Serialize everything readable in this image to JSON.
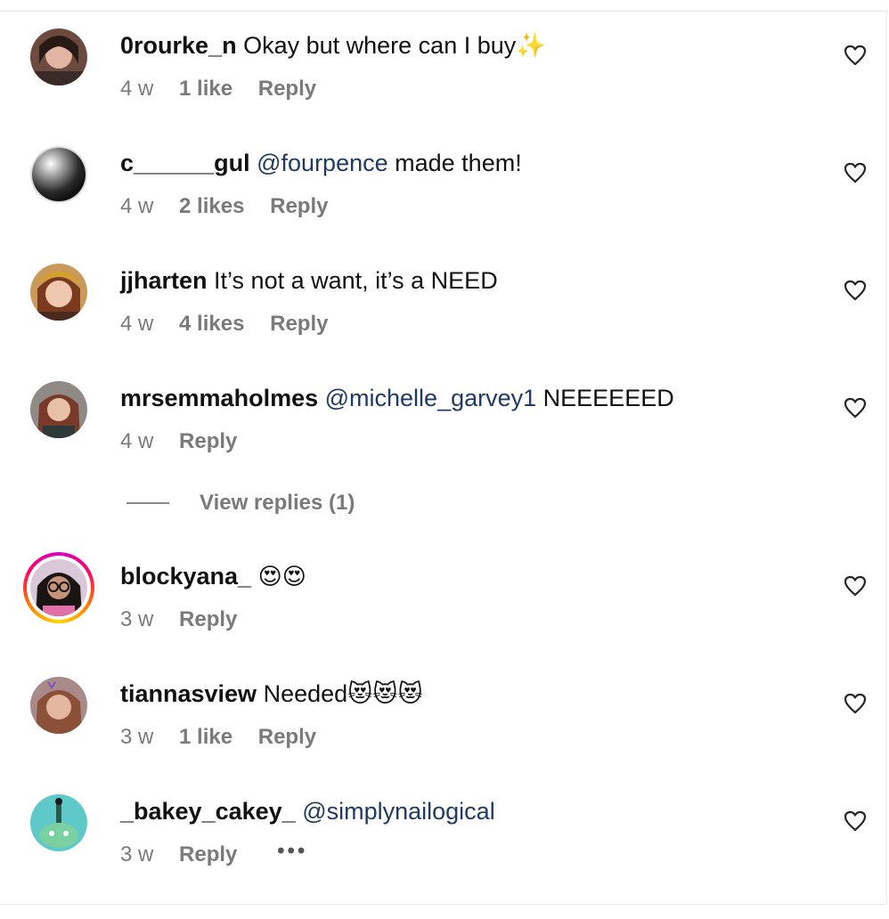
{
  "comments": [
    {
      "username": "0rourke_n",
      "mention": "",
      "text": "Okay but where can I buy✨",
      "time": "4 w",
      "likes": "1 like",
      "reply": "Reply",
      "avatar": "avatar-woman-dark-hair"
    },
    {
      "username": "c______gul",
      "mention": "@fourpence",
      "text": "made them!",
      "time": "4 w",
      "likes": "2 likes",
      "reply": "Reply",
      "avatar": "avatar-chrome-sphere"
    },
    {
      "username": "jjharten",
      "mention": "",
      "text": "It’s not a want, it’s a NEED",
      "time": "4 w",
      "likes": "4 likes",
      "reply": "Reply",
      "avatar": "avatar-woman-smiling"
    },
    {
      "username": "mrsemmaholmes",
      "mention": "@michelle_garvey1",
      "text": "NEEEEEED",
      "time": "4 w",
      "likes": "",
      "reply": "Reply",
      "avatar": "avatar-woman-red-hair"
    },
    {
      "username": "blockyana_",
      "mention": "",
      "text": "😍😍",
      "time": "3 w",
      "likes": "",
      "reply": "Reply",
      "avatar": "avatar-woman-glasses-story-ring"
    },
    {
      "username": "tiannasview",
      "mention": "",
      "text": "Needed😻😻😻",
      "time": "3 w",
      "likes": "1 like",
      "reply": "Reply",
      "avatar": "avatar-woman-brown-hair"
    },
    {
      "username": "_bakey_cakey_",
      "mention": "@simplynailogical",
      "text": "",
      "time": "3 w",
      "likes": "",
      "reply": "Reply",
      "more": "•••",
      "avatar": "avatar-cartoon-character"
    }
  ],
  "view_replies": "View replies (1)",
  "icons": {
    "like": "heart-outline-icon",
    "more": "more-dots-icon"
  },
  "colors": {
    "mention": "#1f3a63",
    "meta": "#7a7a7a",
    "username": "#111111"
  }
}
